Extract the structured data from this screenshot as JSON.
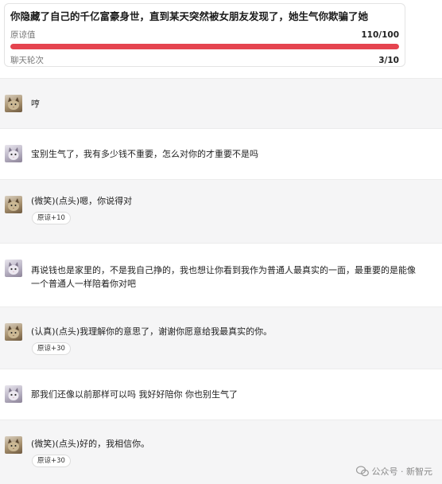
{
  "scenario": {
    "title": "你隐藏了自己的千亿富豪身世，直到某天突然被女朋友发现了，她生气你欺骗了她",
    "forgiveness_label": "原谅值",
    "forgiveness_value": "110/100",
    "forgiveness_progress": 1.0,
    "round_label": "聊天轮次",
    "round_value": "3/10"
  },
  "colors": {
    "progress_fill": "#e5444f",
    "ai_row_bg": "#f5f5f6",
    "user_row_bg": "#ffffff"
  },
  "messages": [
    {
      "role": "ai",
      "avatar": "cat-avatar-icon",
      "text": "哼",
      "badge": ""
    },
    {
      "role": "user",
      "avatar": "kitten-avatar-icon",
      "text": "宝别生气了，我有多少钱不重要，怎么对你的才重要不是吗",
      "badge": ""
    },
    {
      "role": "ai",
      "avatar": "cat-avatar-icon",
      "text": "(微笑)(点头)嗯，你说得对",
      "badge": "原谅+10"
    },
    {
      "role": "user",
      "avatar": "kitten-avatar-icon",
      "text": "再说钱也是家里的，不是我自己挣的，我也想让你看到我作为普通人最真实的一面，最重要的是能像一个普通人一样陪着你对吧",
      "badge": ""
    },
    {
      "role": "ai",
      "avatar": "cat-avatar-icon",
      "text": "(认真)(点头)我理解你的意思了，谢谢你愿意给我最真实的你。",
      "badge": "原谅+30"
    },
    {
      "role": "user",
      "avatar": "kitten-avatar-icon",
      "text": "那我们还像以前那样可以吗 我好好陪你 你也别生气了",
      "badge": ""
    },
    {
      "role": "ai",
      "avatar": "cat-avatar-icon",
      "text": "(微笑)(点头)好的，我相信你。",
      "badge": "原谅+30"
    }
  ],
  "watermark": {
    "icon": "wechat-icon",
    "text": "公众号 · 新智元"
  }
}
